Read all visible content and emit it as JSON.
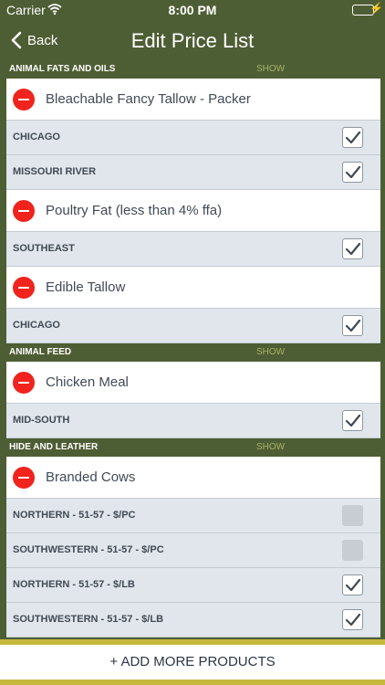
{
  "status_bar": {
    "carrier": "Carrier",
    "time": "8:00 PM",
    "wifi_icon": "wifi-icon",
    "battery_icon": "battery-icon"
  },
  "nav": {
    "back_label": "Back",
    "title": "Edit Price List"
  },
  "sections": [
    {
      "name": "ANIMAL FATS AND OILS",
      "show": "SHOW",
      "products": [
        {
          "name": "Bleachable Fancy Tallow - Packer",
          "regions": [
            {
              "label": "CHICAGO",
              "checked": true
            },
            {
              "label": "MISSOURI RIVER",
              "checked": true
            }
          ]
        },
        {
          "name": "Poultry Fat (less than 4% ffa)",
          "regions": [
            {
              "label": "SOUTHEAST",
              "checked": true
            }
          ]
        },
        {
          "name": "Edible Tallow",
          "regions": [
            {
              "label": "CHICAGO",
              "checked": true
            }
          ]
        }
      ]
    },
    {
      "name": "ANIMAL FEED",
      "show": "SHOW",
      "products": [
        {
          "name": "Chicken Meal",
          "regions": [
            {
              "label": "MID-SOUTH",
              "checked": true
            }
          ]
        }
      ]
    },
    {
      "name": "HIDE AND LEATHER",
      "show": "SHOW",
      "products": [
        {
          "name": "Branded Cows",
          "regions": [
            {
              "label": "NORTHERN - 51-57 - $/PC",
              "checked": false
            },
            {
              "label": "SOUTHWESTERN - 51-57 - $/PC",
              "checked": false
            },
            {
              "label": "NORTHERN - 51-57 - $/LB",
              "checked": true
            },
            {
              "label": "SOUTHWESTERN - 51-57 - $/LB",
              "checked": true
            }
          ]
        }
      ]
    }
  ],
  "footer": {
    "add_label": "+ ADD MORE PRODUCTS"
  },
  "colors": {
    "header_green": "#4e5e34",
    "show_text": "#a8b36a",
    "delete_red": "#f0231d",
    "footer_gold": "#c6b83e"
  }
}
